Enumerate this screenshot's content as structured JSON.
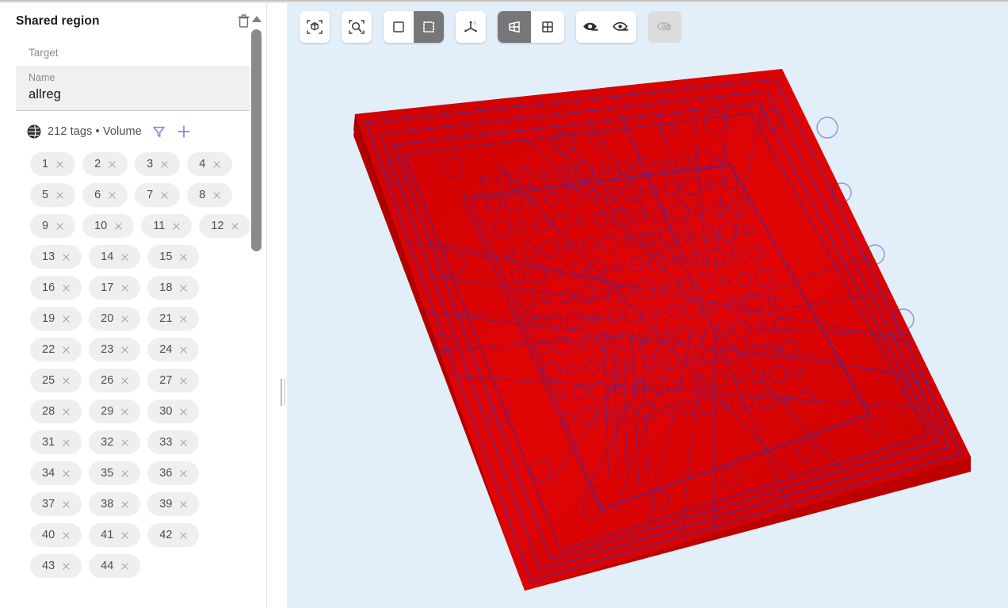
{
  "panel": {
    "title": "Shared region",
    "delete_icon": "trash-icon",
    "target": {
      "label": "Target",
      "value": ""
    },
    "name": {
      "label": "Name",
      "value": "allreg"
    },
    "tags_meta": {
      "globe_icon": "globe-icon",
      "text": "212 tags • Volume",
      "tag_count": 212,
      "kind": "Volume",
      "filter_icon": "filter-icon",
      "add_icon": "plus-icon",
      "accent_color": "#8a7fe0"
    },
    "chips": [
      "1",
      "2",
      "3",
      "4",
      "5",
      "6",
      "7",
      "8",
      "9",
      "10",
      "11",
      "12",
      "13",
      "14",
      "15",
      "16",
      "17",
      "18",
      "19",
      "20",
      "21",
      "22",
      "23",
      "24",
      "25",
      "26",
      "27",
      "28",
      "29",
      "30",
      "31",
      "32",
      "33",
      "34",
      "35",
      "36",
      "37",
      "38",
      "39",
      "40",
      "41",
      "42",
      "43",
      "44"
    ],
    "chip_remove_icon": "close-icon",
    "scrollbar": {
      "up_arrow_icon": "triangle-up-icon",
      "thumb": "scrollbar-thumb"
    }
  },
  "toolbar": {
    "groups": [
      {
        "name": "fit-group",
        "buttons": [
          {
            "name": "fit-to-view-button",
            "icon": "cube-fit-icon",
            "state": "normal"
          }
        ]
      },
      {
        "name": "zoom-group",
        "buttons": [
          {
            "name": "zoom-to-selection-button",
            "icon": "magnifier-fit-icon",
            "state": "normal"
          }
        ]
      },
      {
        "name": "selection-mode-group",
        "buttons": [
          {
            "name": "rectangle-select-button",
            "icon": "square-outline-icon",
            "state": "normal"
          },
          {
            "name": "marquee-select-button",
            "icon": "dotted-square-icon",
            "state": "active"
          }
        ]
      },
      {
        "name": "axes-group",
        "buttons": [
          {
            "name": "show-axes-button",
            "icon": "axes-icon",
            "state": "normal"
          }
        ]
      },
      {
        "name": "projection-group",
        "buttons": [
          {
            "name": "perspective-view-button",
            "icon": "perspective-icon",
            "state": "active"
          },
          {
            "name": "orthographic-view-button",
            "icon": "orthographic-grid-icon",
            "state": "normal"
          }
        ]
      },
      {
        "name": "visibility-group",
        "buttons": [
          {
            "name": "hide-selected-button",
            "icon": "eye-filled-minus-icon",
            "state": "normal"
          },
          {
            "name": "hide-unselected-button",
            "icon": "eye-outline-minus-icon",
            "state": "normal"
          }
        ]
      },
      {
        "name": "restore-visibility-group",
        "buttons": [
          {
            "name": "restore-visibility-button",
            "icon": "eye-refresh-icon",
            "state": "disabled"
          }
        ]
      }
    ]
  },
  "viewport": {
    "name": "3d-viewport",
    "background_color": "#e2eff9",
    "model": {
      "name": "pcb-substrate-model",
      "fill_color": "#d40000",
      "edge_color": "#3a2fa0",
      "description": "semi-transparent red rectangular PCB substrate in 3D perspective"
    }
  }
}
